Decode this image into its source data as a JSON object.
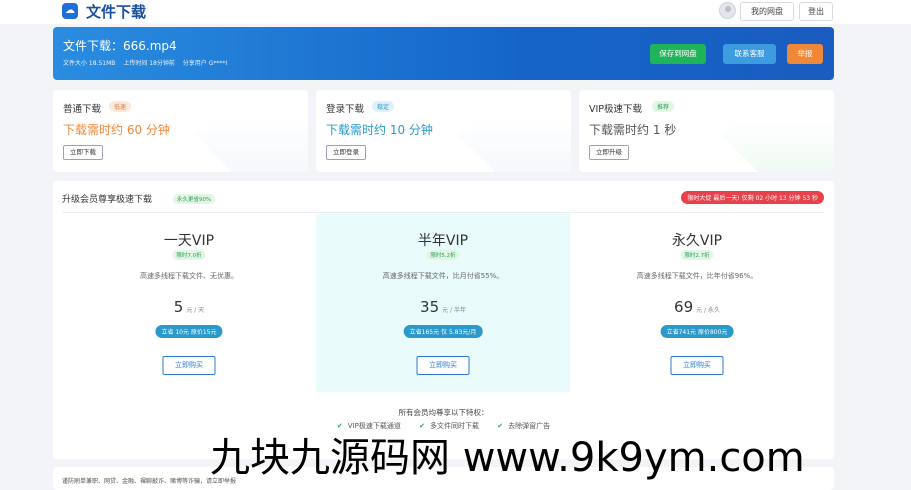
{
  "header": {
    "site_title": "文件下载",
    "my_disk": "我的网盘",
    "logout": "登出"
  },
  "banner": {
    "title": "文件下载：666.mp4",
    "file_size": "文件大小 18.51MB",
    "upload_time": "上传时间 18分钟前",
    "sharer": "分享用户 G****I",
    "save_button": "保存到网盘",
    "support_button": "联系客服",
    "report_button": "举报",
    "colors": {
      "save": "#1fb35a",
      "support": "#3d9be0",
      "report": "#f0883a"
    }
  },
  "download_cards": [
    {
      "title": "普通下载",
      "tag": "低速",
      "time": "下载需时约 60 分钟",
      "button": "立即下载",
      "accent": "#f0883a"
    },
    {
      "title": "登录下载",
      "tag": "稳定",
      "time": "下载需时约 10 分钟",
      "button": "立即登录",
      "accent": "#2b99c9"
    },
    {
      "title": "VIP极速下载",
      "tag": "推荐",
      "time": "下载需时约 1 秒",
      "button": "立即升级",
      "accent": "#2e9e52"
    }
  ],
  "vip": {
    "title": "升级会员尊享极速下载",
    "tag": "永久更省90%",
    "timer": "限时大促 最后一天! 仅剩 02 小时 13 分钟 53 秒",
    "plans": [
      {
        "name": "一天VIP",
        "discount": "限时7.0折",
        "desc": "高速多线程下载文件、无优惠。",
        "price": "5",
        "unit": "元 / 天",
        "save": "立省 10元 原价15元",
        "buy": "立即购买"
      },
      {
        "name": "半年VIP",
        "discount": "限时5.2折",
        "desc": "高速多线程下载文件，比月付省55%。",
        "price": "35",
        "unit": "元 / 半年",
        "save": "立省165元 仅 5.83元/月",
        "buy": "立即购买"
      },
      {
        "name": "永久VIP",
        "discount": "限时2.7折",
        "desc": "高速多线程下载文件，比年付省96%。",
        "price": "69",
        "unit": "元 / 永久",
        "save": "立省741元 原价800元",
        "buy": "立即购买"
      }
    ],
    "privileges_title": "所有会员均尊享以下特权：",
    "privileges": [
      "VIP极速下载通道",
      "多文件同时下载",
      "去除弹窗广告"
    ]
  },
  "footer": {
    "text": "谨防刷单兼职、网贷、金融、裸聊敲诈、赌博等诈骗，请立即举报"
  },
  "watermark": "九块九源码网 www.9k9ym.com"
}
